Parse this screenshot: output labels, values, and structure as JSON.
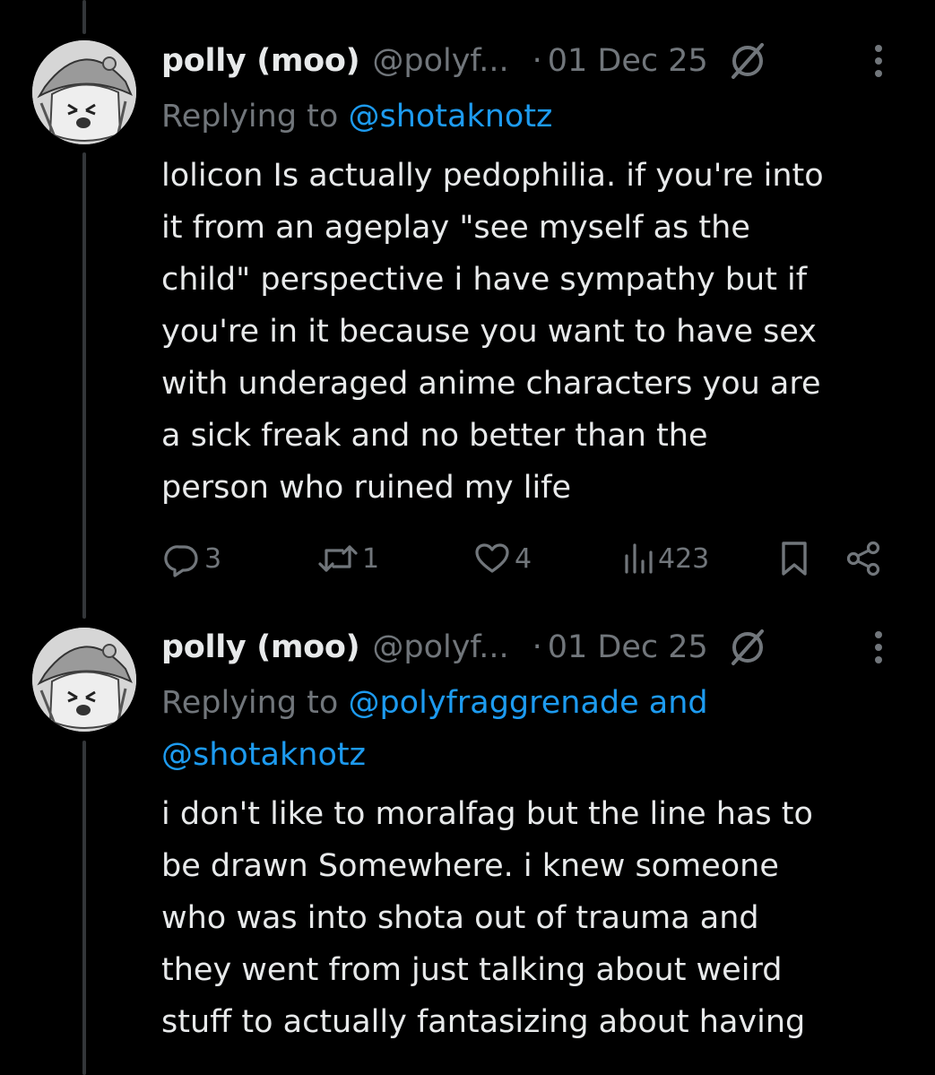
{
  "tweets": [
    {
      "display_name": "polly (moo)",
      "handle": "@polyf...",
      "separator": "·",
      "date": "01 Dec 25",
      "replying_prefix": "Replying to",
      "replying_mentions_line1": "@shotaknotz",
      "replying_mentions_line2": "",
      "body_lines": [
        "lolicon Is actually pedophilia. if you're into",
        "it from an ageplay \"see myself as the",
        "child\" perspective i have sympathy but if",
        "you're in it because you want to have sex",
        "with underaged anime characters you are",
        "a sick freak and no better than the",
        "person who ruined my life"
      ],
      "replies": "3",
      "reposts": "1",
      "likes": "4",
      "views": "423"
    },
    {
      "display_name": "polly (moo)",
      "handle": "@polyf...",
      "separator": "·",
      "date": "01 Dec 25",
      "replying_prefix": "Replying to",
      "replying_mentions_line1": "@polyfraggrenade and",
      "replying_mentions_line2": "@shotaknotz",
      "body_lines": [
        "i don't like to moralfag but the line has to",
        "be drawn Somewhere. i knew someone",
        "who was into shota out of trauma and",
        "they went from just talking about weird",
        "stuff to actually fantasizing about having"
      ]
    }
  ],
  "icons": {
    "reply": "reply-icon",
    "repost": "repost-icon",
    "like": "heart-icon",
    "views": "views-icon",
    "bookmark": "bookmark-icon",
    "share": "share-icon",
    "grok": "grok-icon",
    "more": "more-icon"
  },
  "colors": {
    "background": "#000000",
    "text": "#e7e9ea",
    "secondary": "#71767b",
    "accent": "#1d9bf0",
    "thread_line": "#333639"
  }
}
